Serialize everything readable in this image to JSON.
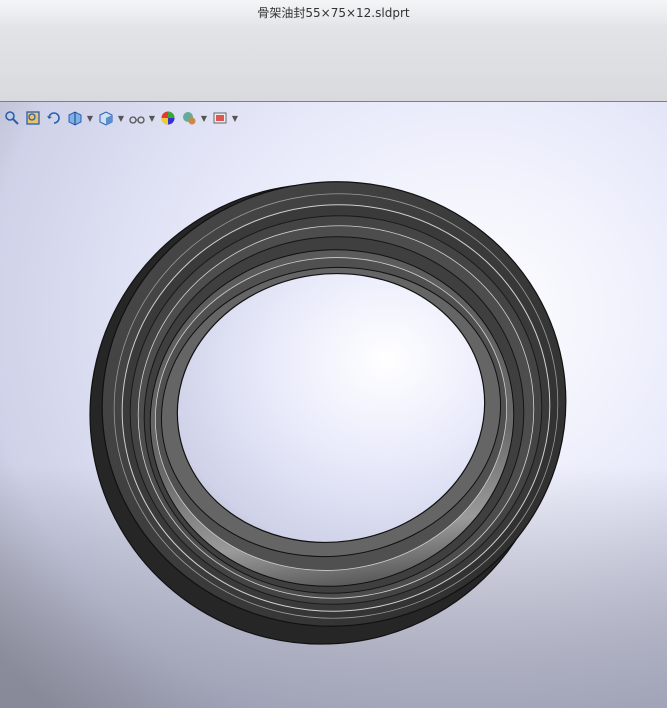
{
  "window": {
    "title": "骨架油封55×75×12.sldprt"
  },
  "colors": {
    "viewport_top": "#d8dcf3",
    "viewport_bottom": "#b8bbc9",
    "part": "#3a3a3a"
  },
  "heads_up_toolbar": {
    "items": [
      {
        "name": "zoom-to-fit-icon",
        "dropdown": false
      },
      {
        "name": "zoom-to-area-icon",
        "dropdown": false
      },
      {
        "name": "previous-view-icon",
        "dropdown": false
      },
      {
        "name": "section-view-icon",
        "dropdown": false
      },
      {
        "name": "view-orientation-icon",
        "dropdown": true
      },
      {
        "name": "display-style-icon",
        "dropdown": true
      },
      {
        "name": "hide-show-items-icon",
        "dropdown": true
      },
      {
        "name": "edit-appearance-icon",
        "dropdown": false
      },
      {
        "name": "apply-scene-icon",
        "dropdown": true
      },
      {
        "name": "view-settings-icon",
        "dropdown": true
      }
    ]
  }
}
